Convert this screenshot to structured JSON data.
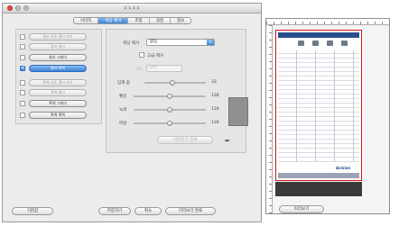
{
  "window": {
    "title": "ㅈㅈㅈㅈ"
  },
  "tabs": [
    {
      "label": "이미지",
      "active": false
    },
    {
      "label": "색상 제거",
      "active": true
    },
    {
      "label": "조정",
      "active": false
    },
    {
      "label": "설정",
      "active": false
    },
    {
      "label": "정보",
      "active": false
    }
  ],
  "left_panel": {
    "items": [
      {
        "label": "컬러 자동 필터 켜기",
        "checked": false,
        "enabled": false,
        "selected": false
      },
      {
        "label": "컬러 필터",
        "checked": false,
        "enabled": false,
        "selected": false
      },
      {
        "label": "컬러 그레이",
        "checked": false,
        "enabled": true,
        "selected": false
      },
      {
        "label": "컬러 흑백",
        "checked": true,
        "enabled": true,
        "selected": true
      },
      {
        "label": "흑백 자동 필터 켜기",
        "checked": false,
        "enabled": false,
        "selected": false
      },
      {
        "label": "흑백 필터",
        "checked": false,
        "enabled": false,
        "selected": false
      },
      {
        "label": "흑백 그레이",
        "checked": false,
        "enabled": true,
        "selected": false
      },
      {
        "label": "흑백 흑백",
        "checked": false,
        "enabled": true,
        "selected": false
      }
    ]
  },
  "right_panel": {
    "color_label": "색상 제거",
    "color_value": "없음",
    "advanced_checkbox_label": "고급 제거",
    "mode_label": "모드",
    "mode_value": "모두",
    "sliders": [
      {
        "label": "임계 값",
        "value": "33",
        "level": 0.45
      },
      {
        "label": "빨강",
        "value": "128",
        "level": 0.5
      },
      {
        "label": "녹색",
        "value": "128",
        "level": 0.5
      },
      {
        "label": "파랑",
        "value": "128",
        "level": 0.5
      }
    ],
    "preview_button": "미리보기 결과",
    "swatch_color": "#909090"
  },
  "footer": {
    "default_button": "기본값",
    "save_button": "저장하기",
    "cancel_button": "취소",
    "preview_done_button": "미리보기 완료",
    "scan_preview_button": "미리보기"
  },
  "preview": {
    "document_header": "",
    "document_logo": "Avision"
  },
  "colors": {
    "accent": "#3f86d8",
    "frame": "#d01818"
  }
}
